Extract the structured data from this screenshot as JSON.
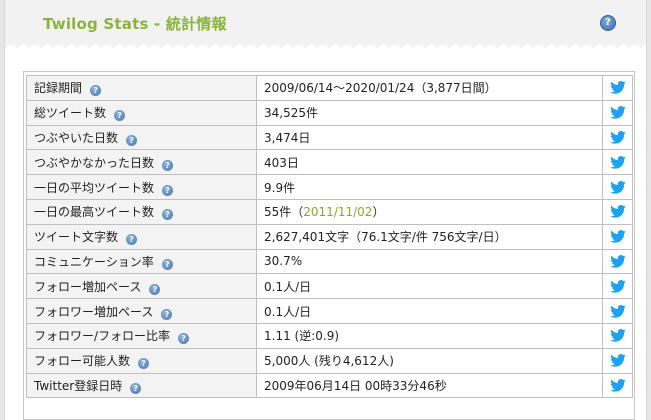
{
  "header": {
    "title": "Twilog Stats - 統計情報",
    "help_glyph": "?"
  },
  "colors": {
    "title": "#8cb43c",
    "link": "#8aa82e",
    "twitter": "#1da1f2",
    "help": "#4672ac"
  },
  "icons": {
    "help": "question-circle-icon",
    "share": "twitter-bird-icon"
  },
  "rows": [
    {
      "label": "記録期間",
      "pre": "2009/06/14～2020/01/24（3,877日間）",
      "link": "",
      "post": ""
    },
    {
      "label": "総ツイート数",
      "pre": "34,525件",
      "link": "",
      "post": ""
    },
    {
      "label": "つぶやいた日数",
      "pre": "3,474日",
      "link": "",
      "post": ""
    },
    {
      "label": "つぶやかなかった日数",
      "pre": "403日",
      "link": "",
      "post": ""
    },
    {
      "label": "一日の平均ツイート数",
      "pre": "9.9件",
      "link": "",
      "post": ""
    },
    {
      "label": "一日の最高ツイート数",
      "pre": "55件（",
      "link": "2011/11/02",
      "post": "）"
    },
    {
      "label": "ツイート文字数",
      "pre": "2,627,401文字（76.1文字/件 756文字/日）",
      "link": "",
      "post": ""
    },
    {
      "label": "コミュニケーション率",
      "pre": "30.7%",
      "link": "",
      "post": ""
    },
    {
      "label": "フォロー増加ペース",
      "pre": "0.1人/日",
      "link": "",
      "post": ""
    },
    {
      "label": "フォロワー増加ペース",
      "pre": "0.1人/日",
      "link": "",
      "post": ""
    },
    {
      "label": "フォロワー/フォロー比率",
      "pre": "1.11 (逆:0.9)",
      "link": "",
      "post": ""
    },
    {
      "label": "フォロー可能人数",
      "pre": "5,000人 (残り4,612人)",
      "link": "",
      "post": ""
    },
    {
      "label": "Twitter登録日時",
      "pre": "2009年06月14日 00時33分46秒",
      "link": "",
      "post": ""
    }
  ]
}
